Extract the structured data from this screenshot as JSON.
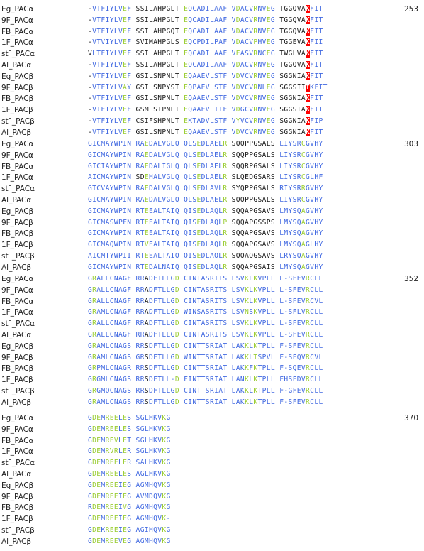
{
  "colors": {
    "k": "#1a1a1a",
    "b": "#4169e1",
    "g": "#9acd32",
    "h": "#ff0000",
    "hl_text": "#ffffff"
  },
  "legend": "k = black residue, b = blue (conserved), g = green (similar), h = red highlighted position",
  "blocks": [
    {
      "end_position": "253",
      "rows": [
        {
          "name": "Eg_PACα",
          "seq": "-VTFIYLVEF SSILAHPGLT EQCADILAAF VDACVRNVEG TGGQVAKFIT",
          "colors": "kbbbbbbbgb kkkkkkkkkk gbbbbbbbbb bgbbbgbbgb kkkkkkhbbb"
        },
        {
          "name": "9F_PACα",
          "seq": "-VTFIYLVEF SSILAHPGLT EQCADILAAF VDACVRNVEG TGGQVAKFIT",
          "colors": "kbbbbbbbgb kkkkkkkkkk gbbbbbbbbb bgbbbgbbgb kkkkkkhbbb"
        },
        {
          "name": "FB_PACα",
          "seq": "-VTFIYLVEF SSILAHPGQT EQCADILAAF VDACVRNVEG TGGQVAKFIT",
          "colors": "kbbbbbbbgb kkkkkkkkkk gbbbbbbbbb bgbbbgbbgb kkkkkkhbbb"
        },
        {
          "name": "1F_PACα",
          "seq": "-VTVIYLVEF SVIMAHPGLS EQCPDILPAF VDACVPHVEG TGGEVAKFII",
          "colors": "kbbbbbbbgb kkkkkkkkkk gbbbbbbbbb bgbbbgbbgb kkkkkkhbbb"
        },
        {
          "name": "stˉ_PACα",
          "seq": "VLTFIYLVEF SSILAHPGLT EQCADILAAF VEASVRNCEG TWGLVAKFIT",
          "colors": "kbbbbbbbgb kkkkkkkkkk gbbbbbbbbb bgbbbgbbgb kkkkkkhbbb"
        },
        {
          "name": "Al_PACα",
          "seq": "-VTFIYLVEF SSILAHPGLT EQCADILAAF VDACVRNVEG TGGQVAKFIT",
          "colors": "kbbbbbbbgb kkkkkkkkkk gbbbbbbbbb bgbbbgbbgb kkkkkkhbbb"
        },
        {
          "name": "Eg_PACβ",
          "seq": "-VTFIYLVEF GSILSNPNLT EQAAEVLSTF VDVCVRNVEG SGGNIAKFIT",
          "colors": "kbbbbbbbgb kkkkkkkkkk gbbbbbbbbb bgbbbgbbgb kkkkkkhbbb"
        },
        {
          "name": "9F_PACβ",
          "seq": "-VTFIYLVAY GSILSNPYST EQPAEVLSTF VDVCVRNLEG SGGSIITKFIT",
          "colors": "kbbbbbbbgb kkkkkkkkkk gbbbbbbbbb bgbbbgbbgb kkkkkkhbbbb"
        },
        {
          "name": "FB_PACβ",
          "seq": "-VTFIYLVEF GSILSNPNLT EQAAEVLSTF VDVCVRNVEG SGGNIAKFIT",
          "colors": "kbbbbbbbgb kkkkkkkkkk gbbbbbbbbb bgbbbgbbgb kkkkkkhbbb"
        },
        {
          "name": "1F_PACβ",
          "seq": "-VTFIYLVEF GSMLSIPNLT EQAAEVLTTF VDGCVRNVEG SGGSIAKFIT",
          "colors": "kbbbbbbbgb kkkkkkkkkk gbbbbbbbbb bgbbbgbbgb kkkkkkhbbb"
        },
        {
          "name": "stˉ_PACβ",
          "seq": "-VTFIYLVEF CSIFSHPNLT EKTADVLSTF VYVCVRNVEG SGGNIAKFIP",
          "colors": "kbbbbbbbgb kkkkkkkkkk gbbbbbbbbb bgbbbgbbgb kkkkkkhbbb"
        },
        {
          "name": "Al_PACβ",
          "seq": "-VTFIYLVEF GSILSNPNLT EQAAEVLSTF VDVCVRNVEG SGGNIAKFIT",
          "colors": "kbbbbbbbgb kkkkkkkkkk gbbbbbbbbb bgbbbgbbgb kkkkkkhbbb"
        }
      ]
    },
    {
      "end_position": "303",
      "rows": [
        {
          "name": "Eg_PACα",
          "seq": "GICMAYWPIN RAEDALVGLQ QLSEDLAELR SQQPPGSALS LIYSRCGVHY",
          "colors": "bbbbbbbbbb bbgbbbbbbb bbbgbbbbbg kkkkkkkkkk bbbbbgbbbb"
        },
        {
          "name": "9F_PACα",
          "seq": "GICMAYWPIN RAEDALVGLQ QLSEDLAELR SQQPPGSALS LIYSRCGVHY",
          "colors": "bbbbbbbbbb bbgbbbbbbb bbbgbbbbbg kkkkkkkkkk bbbbbgbbbb"
        },
        {
          "name": "FB_PACα",
          "seq": "GICIAYWPIN RAEDALIGLQ QLSEDLAELR SQQRPGSALS LIYSRCGVHY",
          "colors": "bbbbbbbbbb bbgbbbbbbb bbbgbbbbbg kkkkkkkkkk bbbbbgbbbb"
        },
        {
          "name": "1F_PACα",
          "seq": "AICMAYWPIN SDEHALVGLQ QLSEDLAELR SLQEDGSARS LIYSRCGLHF",
          "colors": "bbbbbbbbbb kkgbbbbbbb bbbgbbbbbg kkkkkkkkkk bbbbbgbbbb"
        },
        {
          "name": "stˉ_PACα",
          "seq": "GTCVAYWPIN RAEDALVGLQ QLSEDLAVLR SYQPPGSALS RIYSRRGVHY",
          "colors": "bbbbbbbbbb bbgbbbbbbb bbbgbbbbbg kkkkkkkkkk bbbbbgbbbb"
        },
        {
          "name": "Al_PACα",
          "seq": "GICMAYWPIN RAEDALVGLQ QLSEDLAELR SQQPPGSALS LIYSRCGVHY",
          "colors": "bbbbbbbbbb bbgbbbbbbb bbbgbbbbbg kkkkkkkkkk bbbbbgbbbb"
        },
        {
          "name": "Eg_PACβ",
          "seq": "GICMAYWPIN RTEEALTAIQ QISEDLAQLR SQQAPGSAVS LMYSQAGVHY",
          "colors": "bbbbbbbbbb bbgbbbbbbb bbbgbbbbbg kkkkkkkkkk bbbbbgbbbb"
        },
        {
          "name": "9F_PACβ",
          "seq": "GICMASWPFN RTEEALTAIQ QISEDLAQLP SQQAPGSSPS LMYSQAGVHY",
          "colors": "bbbbbbbbbb bbgbbbbbbb bbbgbbbbbg kkkkkkkkkk bbbbbgbbbb"
        },
        {
          "name": "FB_PACβ",
          "seq": "GICMAYWPIN RTEEALTAIQ QISEDLAQLR SQQAPGSAVS LMYSQAGVHY",
          "colors": "bbbbbbbbbb bbgbbbbbbb bbbgbbbbbg kkkkkkkkkk bbbbbgbbbb"
        },
        {
          "name": "1F_PACβ",
          "seq": "GICMAQWPIN RTVEALTAIQ QISEDLAQLR SQQAPGSAVS LMYSQAGLHY",
          "colors": "bbbbbbbbbb bbgbbbbbbb bbbgbbbbbg kkkkkkkkkk bbbbbgbbbb"
        },
        {
          "name": "stˉ_PACβ",
          "seq": "AICMTYWPII RTEEALTAIQ QISEDLAQLR SQQAQGSAVS LRYSQAGVHY",
          "colors": "bbbbbbbbbb bbgbbbbbbb bbbgbbbbbg kkkkkkkkkk bbbbbgbbbb"
        },
        {
          "name": "Al_PACβ",
          "seq": "GICMAYWPIN RTEDALNAIQ QISEDLAQLR SQQAPGSAIS LMYSQAGVHY",
          "colors": "bbbbbbbbbb bbgbbbbbbb bbbgbbbbbg kkkkkkkkkk bbbbbgbbbb"
        }
      ]
    },
    {
      "end_position": "352",
      "rows": [
        {
          "name": "Eg_PACα",
          "seq": "GRALLCNAGF RRADFTLLGD CINTASRITS LSVKLKVPLL L-SFEVRCLL",
          "colors": "bgbbbbbbbb bbkbbbbbbg bbbbbbbbbb bbbgbgbbbb bbbbbbgbbb"
        },
        {
          "name": "9F_PACα",
          "seq": "GRALLCNAGF RRADFTLLGD CINTASRITS LSVKLKVPLL L-SFEVRCLL",
          "colors": "bgbbbbbbbb bbkbbbbbbg bbbbbbbbbb bbbgbgbbbb bbbbbbgbbb"
        },
        {
          "name": "FB_PACα",
          "seq": "GRALLCNAGF RRADFTLLGD CINTASRITS LSVKLKVPLL L-SFEVRCVL",
          "colors": "bgbbbbbbbb bbkbbbbbbg bbbbbbbbbb bbbgbgbbbb bbbbbbgbbb"
        },
        {
          "name": "1F_PACα",
          "seq": "GRAMLCNAGF RRADFTLLGD WINSASRITS LSVNSKVPLL L-SFLVRCLL",
          "colors": "bgbbbbbbbb bbkbbbbbbg bbbbbbbbbb bbbgbgbbbb bbbbbbgbbb"
        },
        {
          "name": "stˉ_PACα",
          "seq": "GRALLCNAGF RRADFTLLGD CINTASRITS LSVKLKVPLL L-SFEVRCLL",
          "colors": "bgbbbbbbbb bbkbbbbbbg bbbbbbbbbb bbbgbgbbbb bbbbbbgbbb"
        },
        {
          "name": "Al_PACα",
          "seq": "GRALLCNAGF RRADFTLLGD CINTASRITS LSVKLKVPLL L-SFEVRCLL",
          "colors": "bgbbbbbbbb bbkbbbbbbg bbbbbbbbbb bbbgbgbbbb bbbbbbgbbb"
        },
        {
          "name": "Eg_PACβ",
          "seq": "GRAMLCNAGS RRSDFTLLGD CINTTSRIAT LAKKLKTPLL F-SFEVRCLL",
          "colors": "bgbbbbbbbb bbkbbbbbbg bbbbbbbbbb bbbgbgbbbb bbbbbbgbbb"
        },
        {
          "name": "9F_PACβ",
          "seq": "GRAMLCNAGS GRSDFTLLGD WINTTSRIAT LAKKLTSPVL F-SFQVRCVL",
          "colors": "bgbbbbbbbb bbkbbbbbbg bbbbbbbbbb bbbgbgbbbb bbbbbbgbbb"
        },
        {
          "name": "FB_PACβ",
          "seq": "GRPMLCNAGR RRSDFTLLGD CINTTSRIAT LAKKFKTPLL F-SQEVRCLL",
          "colors": "bgbbbbbbbb bbkbbbbbbg bbbbbbbbbb bbbgbgbbbb bbbbbbgbbb"
        },
        {
          "name": "1F_PACβ",
          "seq": "GRGMLCNAGS RRSDFTLL-D FINTTSRIAT LANKLKTPLL FHSFDVRCLL",
          "colors": "bgbbbbbbbb bbkbbbbbbg bbbbbbbbbb bbbgbgbbbb bbbbbbgbbb"
        },
        {
          "name": "stˉ_PACβ",
          "seq": "GRGMQCNAGS RRSDFTLLGD CINTTSRIAT LAKKLKTPLL F-GFEVRCLL",
          "colors": "bgbbbbbbbb bbkbbbbbbg bbbbbbbbbb bbbgbgbbbb bbbbbbgbbb"
        },
        {
          "name": "Al_PACβ",
          "seq": "GRAMLCNAGS RRSDFTLLGD CINTTSRIAT LAKKLKTPLL F-SFEVRCLL",
          "colors": "bgbbbbbbbb bbkbbbbbbg bbbbbbbbbb bbbgbgbbbb bbbbbbgbbb"
        }
      ]
    },
    {
      "end_position": "370",
      "rows": [
        {
          "name": "Eg_PACα",
          "seq": "GDEMREELES SGLHKVKG",
          "colors": "bggbgggbgb bbbbbbgb"
        },
        {
          "name": "9F_PACα",
          "seq": "GDEMREELES SGLHKVKG",
          "colors": "bggbgggbgb bbbbbbgb"
        },
        {
          "name": "FB_PACα",
          "seq": "GDEMREVLET SGLHKVKG",
          "colors": "bggbgggbgb bbbbbbgb"
        },
        {
          "name": "1F_PACα",
          "seq": "GDEMRVRLER SGLHKVKG",
          "colors": "bggbgggbgb bbbbbbgb"
        },
        {
          "name": "stˉ_PACα",
          "seq": "GDEMREELER SALHKVKG",
          "colors": "bggbgggbgb bbbbbbgb"
        },
        {
          "name": "Al_PACα",
          "seq": "GDEMREELES AGLHKVKG",
          "colors": "bggbgggbgb bbbbbbgb"
        },
        {
          "name": "Eg_PACβ",
          "seq": "GDEMREEIEG AGMHQVKG",
          "colors": "bggbgggbgb bbbbbbgb"
        },
        {
          "name": "9F_PACβ",
          "seq": "GDEMREEIEG AVMDQVKG",
          "colors": "bggbgggbgb bbbbbbgb"
        },
        {
          "name": "FB_PACβ",
          "seq": "RDEMREEIVG AGMHQVKG",
          "colors": "bggbgggbgb bbbbbbgb"
        },
        {
          "name": "1F_PACβ",
          "seq": "GDEMREEIEG AGMHQVK-",
          "colors": "bggbgggbgb bbbbbbgb"
        },
        {
          "name": "stˉ_PACβ",
          "seq": "GDEKREEIEG AGIHQVKG",
          "colors": "bggbgggbgb bbbbbbgb"
        },
        {
          "name": "Al_PACβ",
          "seq": "GDEMREEVEG AGMHQVKG",
          "colors": "bggbgggbgb bbbbbbgb"
        }
      ]
    }
  ]
}
